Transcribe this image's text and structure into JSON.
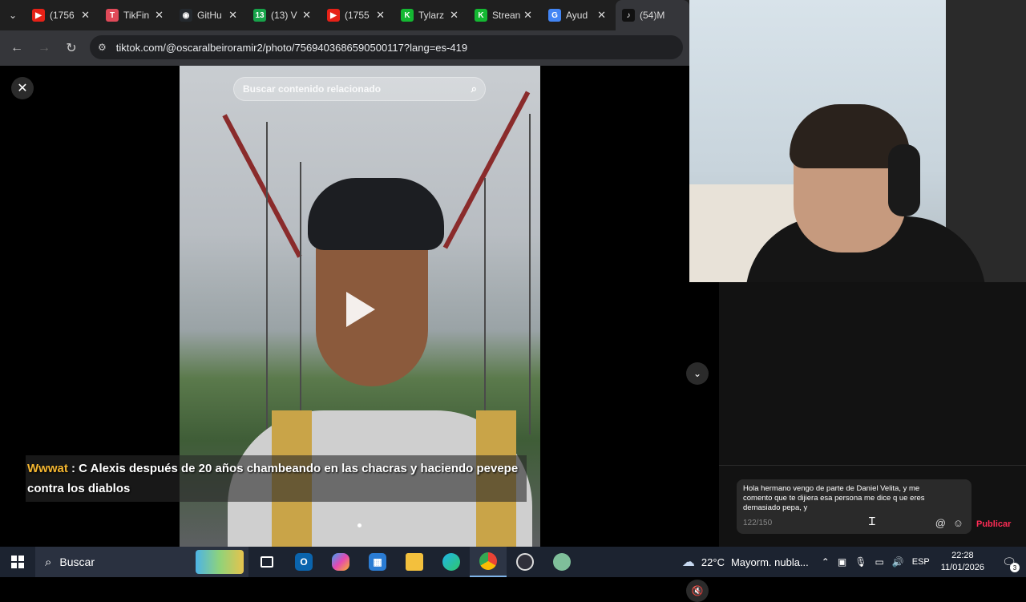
{
  "browser": {
    "tabs": [
      {
        "label": "(1756",
        "color": "#e62117",
        "glyph": "▶"
      },
      {
        "label": "TikFin",
        "color": "#e04a59",
        "glyph": "T"
      },
      {
        "label": "GitHu",
        "color": "#24292e",
        "glyph": "◉"
      },
      {
        "label": "(13) V",
        "color": "#17a34a",
        "glyph": "13"
      },
      {
        "label": "(1755",
        "color": "#e62117",
        "glyph": "▶"
      },
      {
        "label": "Tylarz",
        "color": "#14b832",
        "glyph": "K"
      },
      {
        "label": "Strean",
        "color": "#14b832",
        "glyph": "K"
      },
      {
        "label": "Ayud",
        "color": "#4285f4",
        "glyph": "G"
      },
      {
        "label": "(54)M",
        "color": "#111111",
        "glyph": "♪"
      }
    ],
    "url": "tiktok.com/@oscaralbeiroramir2/photo/7569403686590500117?lang=es-419"
  },
  "viewer": {
    "search_placeholder": "Buscar contenido relacionado",
    "chat_user": "Wwwat",
    "chat_text": " : C Alexis después de 20 años chambeando en las chacras y haciendo pevepe contra los diablos"
  },
  "comment": {
    "text": "Hola hermano vengo de parte de Daniel Velita,  y me comento que te dijiera  esa persona me dice q ue eres demasiado pepa, y",
    "count": "122/150",
    "publish_label": "Publicar"
  },
  "taskbar": {
    "search_label": "Buscar",
    "temperature": "22°C",
    "weather": "Mayorm. nubla...",
    "language": "ESP",
    "time": "22:28",
    "date": "11/01/2026",
    "notifications": "3"
  }
}
